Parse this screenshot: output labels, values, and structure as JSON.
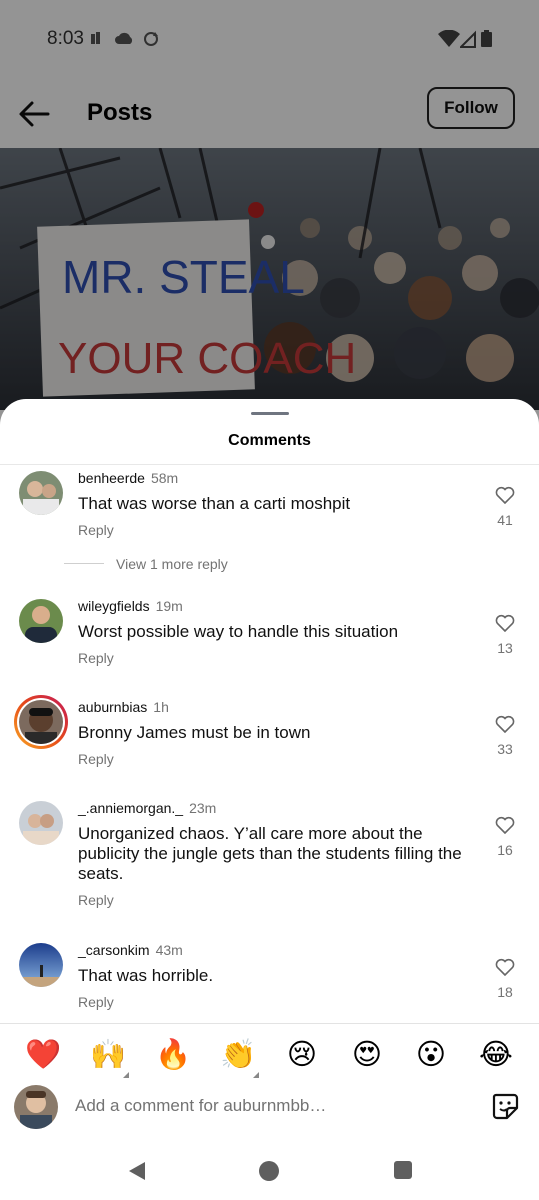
{
  "status_bar": {
    "time": "8:03"
  },
  "app_bar": {
    "title": "Posts",
    "follow_label": "Follow"
  },
  "post": {
    "sign_text_top": "MR. STEAL",
    "sign_text_bottom": "YOUR COACH"
  },
  "sheet": {
    "title": "Comments"
  },
  "comments": [
    {
      "username": "benheerde",
      "time": "58m",
      "text": "That was worse than a carti moshpit",
      "reply_label": "Reply",
      "likes": "41",
      "view_replies": "View 1 more reply"
    },
    {
      "username": "wileygfields",
      "time": "19m",
      "text": "Worst possible way to handle this situation",
      "reply_label": "Reply",
      "likes": "13"
    },
    {
      "username": "auburnbias",
      "time": "1h",
      "text": "Bronny James must be in town",
      "reply_label": "Reply",
      "likes": "33"
    },
    {
      "username": "_.anniemorgan._",
      "time": "23m",
      "text": "Unorganized chaos. Y’all care more about the publicity the jungle gets than the students filling the seats.",
      "reply_label": "Reply",
      "likes": "16"
    },
    {
      "username": "_carsonkim",
      "time": "43m",
      "text": "That was horrible.",
      "reply_label": "Reply",
      "likes": "18"
    }
  ],
  "reactions": [
    "❤️",
    "🙌",
    "🔥",
    "👏",
    "😢",
    "😍",
    "😮",
    "😂"
  ],
  "composer": {
    "placeholder": "Add a comment for auburnmbb…"
  },
  "colors": {
    "heart_red": "#e0245e",
    "story_ring_start": "#f9a825",
    "story_ring_end": "#c2185b"
  }
}
